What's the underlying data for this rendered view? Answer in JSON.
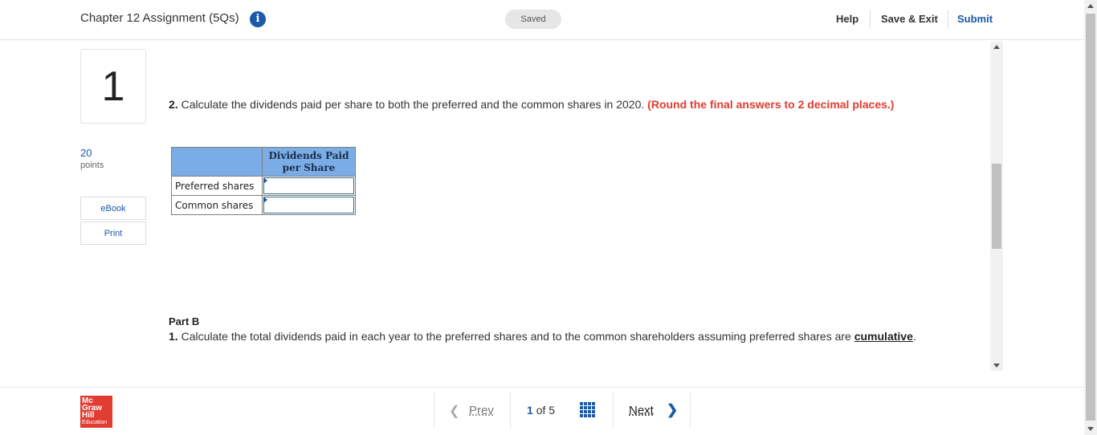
{
  "header": {
    "assignment_title": "Chapter 12 Assignment (5Qs)",
    "info_icon": "info-icon",
    "saved_status": "Saved",
    "help_label": "Help",
    "save_exit_label": "Save & Exit",
    "submit_label": "Submit"
  },
  "sidebar": {
    "question_number": "1",
    "points_value": "20",
    "points_label": "points",
    "ebook_label": "eBook",
    "print_label": "Print"
  },
  "question": {
    "number": "2.",
    "text": " Calculate the dividends paid per share to both the preferred and the common shares in 2020. ",
    "instruction": "(Round the final answers to 2 decimal places.)"
  },
  "answer_table": {
    "column_header": "Dividends Paid per Share",
    "rows": [
      {
        "label": "Preferred shares",
        "value": ""
      },
      {
        "label": "Common shares",
        "value": ""
      }
    ]
  },
  "part_b": {
    "title": "Part B",
    "number": "1.",
    "text": " Calculate the total dividends paid in each year to the preferred shares and to the common shareholders assuming preferred shares are ",
    "link": "cumulative",
    "end": "."
  },
  "footer": {
    "logo_lines": [
      "Mc",
      "Graw",
      "Hill",
      "Education"
    ],
    "prev_label": "Prev",
    "current_page": "1",
    "of_label": "of",
    "total_pages": "5",
    "next_label": "Next"
  },
  "colors": {
    "brand_blue": "#1a5aa8",
    "instruction_red": "#e03c31",
    "table_header": "#7aade6",
    "logo_red": "#e03c31"
  }
}
